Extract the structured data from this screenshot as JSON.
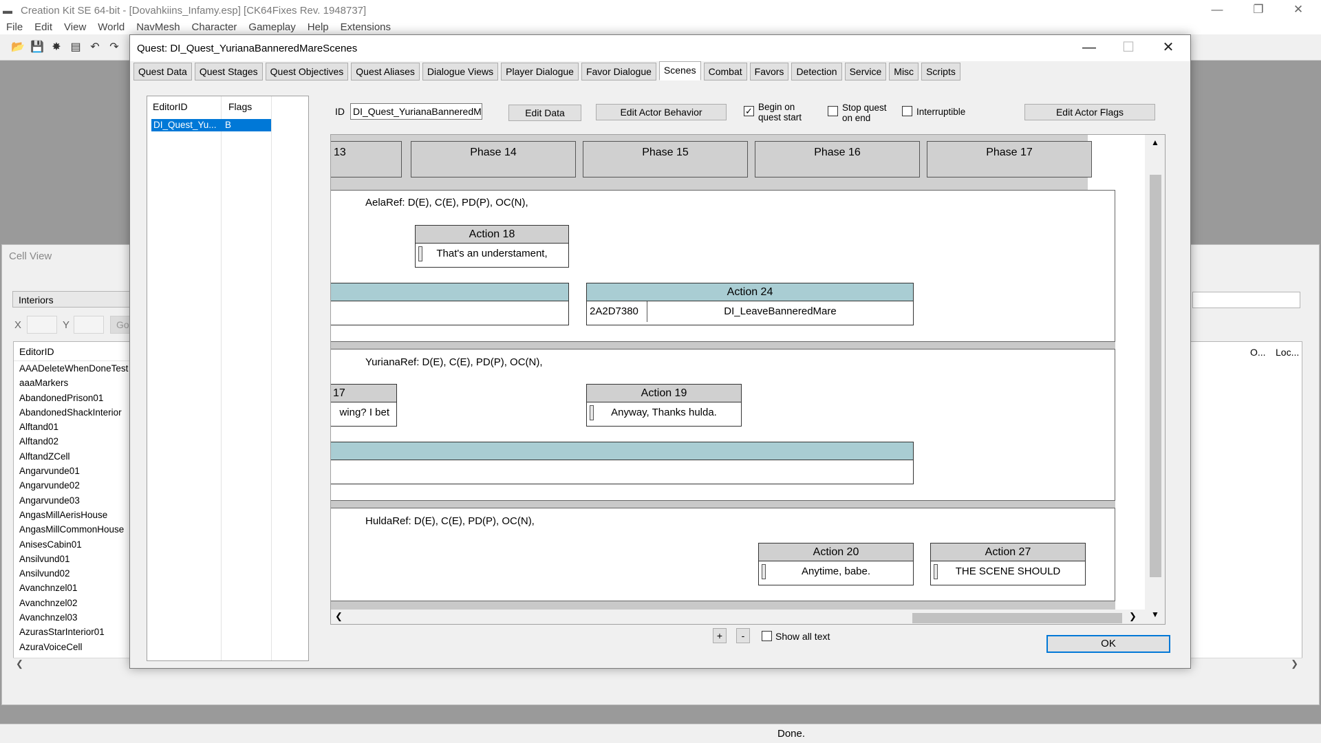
{
  "app": {
    "title": "Creation Kit SE 64-bit - [Dovahkiins_Infamy.esp] [CK64Fixes Rev. 1948737]",
    "menu": [
      "File",
      "Edit",
      "View",
      "World",
      "NavMesh",
      "Character",
      "Gameplay",
      "Help",
      "Extensions"
    ],
    "window_controls": {
      "minimize": "—",
      "restore": "❐",
      "close": "✕"
    },
    "toolbar_icons": [
      "open-folder-icon",
      "save-icon",
      "plugin-icon",
      "data-icon",
      "undo-icon",
      "redo-icon"
    ]
  },
  "cell_view": {
    "title": "Cell View",
    "interiors": "Interiors",
    "x_label": "X",
    "y_label": "Y",
    "go_label": "Go",
    "column_editorid": "EditorID",
    "column_o": "O...",
    "column_loc": "Loc...",
    "cells": [
      "AAADeleteWhenDoneTest",
      "aaaMarkers",
      "AbandonedPrison01",
      "AbandonedShackInterior",
      "Alftand01",
      "Alftand02",
      "AlftandZCell",
      "Angarvunde01",
      "Angarvunde02",
      "Angarvunde03",
      "AngasMillAerisHouse",
      "AngasMillCommonHouse",
      "AnisesCabin01",
      "Ansilvund01",
      "Ansilvund02",
      "Avanchnzel01",
      "Avanchnzel02",
      "Avanchnzel03",
      "AzurasStarInterior01",
      "AzuraVoiceCell"
    ]
  },
  "status": {
    "text": "Done."
  },
  "quest": {
    "title": "Quest: DI_Quest_YurianaBanneredMareScenes",
    "tabs": [
      "Quest Data",
      "Quest Stages",
      "Quest Objectives",
      "Quest Aliases",
      "Dialogue Views",
      "Player Dialogue",
      "Favor Dialogue",
      "Scenes",
      "Combat",
      "Favors",
      "Detection",
      "Service",
      "Misc",
      "Scripts"
    ],
    "active_tab": "Scenes",
    "scene_list": {
      "col_editorid": "EditorID",
      "col_flags": "Flags",
      "row_editorid": "DI_Quest_Yu...",
      "row_flags": "B"
    },
    "id_label": "ID",
    "id_value": "DI_Quest_YurianaBanneredMa",
    "edit_data": "Edit Data",
    "edit_actor_behavior": "Edit Actor Behavior",
    "begin_on_start": "Begin on quest start",
    "begin_on_start_checked": true,
    "stop_on_end": "Stop quest on end",
    "stop_on_end_checked": false,
    "interruptible": "Interruptible",
    "interruptible_checked": false,
    "edit_actor_flags": "Edit Actor Flags",
    "phases": [
      "13",
      "Phase 14",
      "Phase 15",
      "Phase 16",
      "Phase 17"
    ],
    "actors": [
      {
        "label": "AelaRef: D(E), C(E), PD(P), OC(N),"
      },
      {
        "label": "YurianaRef: D(E), C(E), PD(P), OC(N),"
      },
      {
        "label": "HuldaRef: D(E), C(E), PD(P), OC(N),"
      }
    ],
    "actions": {
      "a18_title": "Action 18",
      "a18_text": "That's an understament,",
      "a24_title": "Action 24",
      "a24_id": "2A2D7380",
      "a24_text": "DI_LeaveBanneredMare",
      "a17_title": "17",
      "a17_text": "wing? I bet",
      "a19_title": "Action 19",
      "a19_text": "Anyway, Thanks hulda.",
      "a20_title": "Action 20",
      "a20_text": "Anytime, babe.",
      "a27_title": "Action 27",
      "a27_text": "THE SCENE SHOULD"
    },
    "zoom_in": "+",
    "zoom_out": "-",
    "show_all_text": "Show all text",
    "ok": "OK"
  }
}
